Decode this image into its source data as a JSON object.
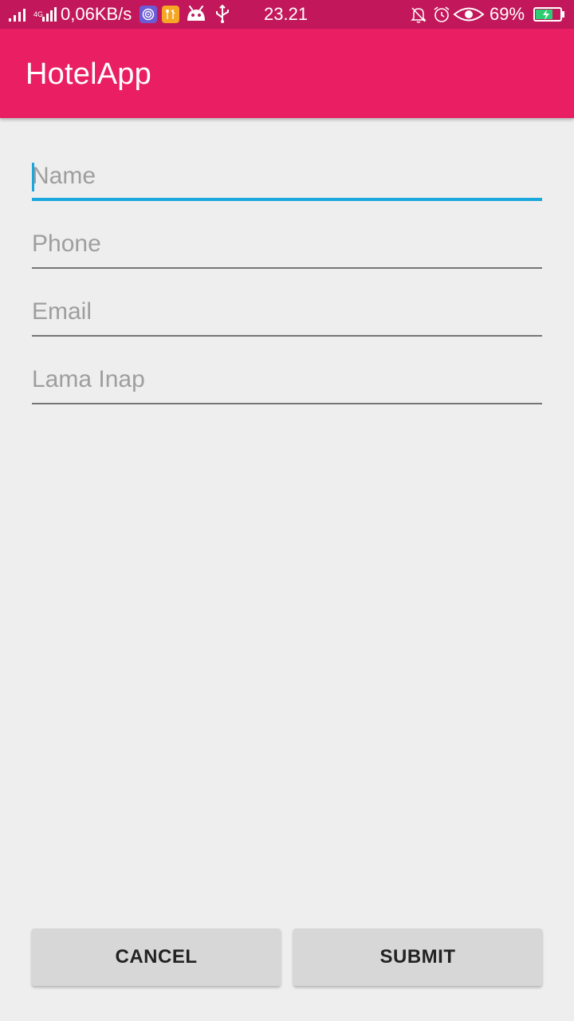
{
  "status_bar": {
    "network_type": "4G",
    "speed": "0,06KB/s",
    "time": "23.21",
    "battery_percent": "69%",
    "icons": [
      "signal-icon",
      "signal-4g-icon",
      "app-target-icon",
      "app-tools-icon",
      "android-icon",
      "usb-icon",
      "bell-off-icon",
      "alarm-icon",
      "eye-icon",
      "battery-charging-icon"
    ],
    "colors": {
      "status_bar_bg": "#c2185b",
      "app_bar_bg": "#e91e63",
      "focus_accent": "#1aa7dc",
      "app1_bg": "#6b5bd6",
      "app2_bg": "#f5a623",
      "battery_fill": "#2ecc71"
    }
  },
  "app_bar": {
    "title": "HotelApp"
  },
  "form": {
    "fields": [
      {
        "placeholder": "Name",
        "value": "",
        "focused": true
      },
      {
        "placeholder": "Phone",
        "value": "",
        "focused": false
      },
      {
        "placeholder": "Email",
        "value": "",
        "focused": false
      },
      {
        "placeholder": "Lama Inap",
        "value": "",
        "focused": false
      }
    ]
  },
  "actions": {
    "cancel_label": "CANCEL",
    "submit_label": "SUBMIT"
  }
}
